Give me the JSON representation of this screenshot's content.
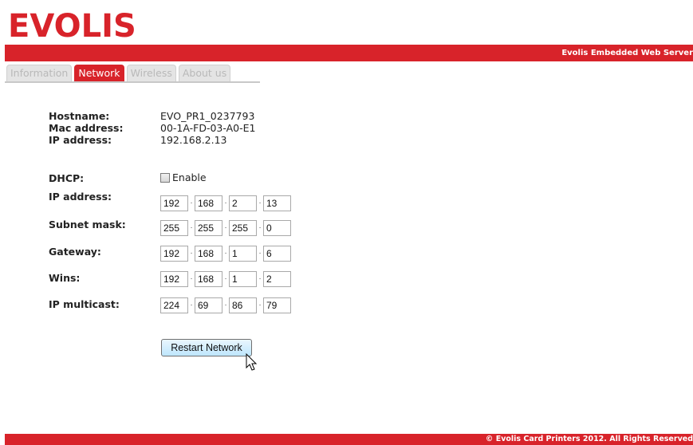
{
  "brand": {
    "logo_text": "EVOLIS",
    "accent_color": "#d8232a"
  },
  "header": {
    "server_title": "Evolis Embedded Web Server"
  },
  "tabs": [
    {
      "label": "Information",
      "active": false
    },
    {
      "label": "Network",
      "active": true
    },
    {
      "label": "Wireless",
      "active": false
    },
    {
      "label": "About us",
      "active": false
    }
  ],
  "info": {
    "hostname": {
      "label": "Hostname:",
      "value": "EVO_PR1_0237793"
    },
    "mac": {
      "label": "Mac address:",
      "value": "00-1A-FD-03-A0-E1"
    },
    "ip": {
      "label": "IP address:",
      "value": "192.168.2.13"
    }
  },
  "form": {
    "dhcp": {
      "label": "DHCP:",
      "checkbox_label": "Enable",
      "checked": false
    },
    "ip_address": {
      "label": "IP address:",
      "octets": [
        "192",
        "168",
        "2",
        "13"
      ]
    },
    "subnet_mask": {
      "label": "Subnet mask:",
      "octets": [
        "255",
        "255",
        "255",
        "0"
      ]
    },
    "gateway": {
      "label": "Gateway:",
      "octets": [
        "192",
        "168",
        "1",
        "6"
      ]
    },
    "wins": {
      "label": "Wins:",
      "octets": [
        "192",
        "168",
        "1",
        "2"
      ]
    },
    "ip_multicast": {
      "label": "IP multicast:",
      "octets": [
        "224",
        "69",
        "86",
        "79"
      ]
    },
    "separator": "·"
  },
  "actions": {
    "restart_label": "Restart Network"
  },
  "footer": {
    "copyright": "© Evolis Card Printers 2012. All Rights Reserved"
  }
}
